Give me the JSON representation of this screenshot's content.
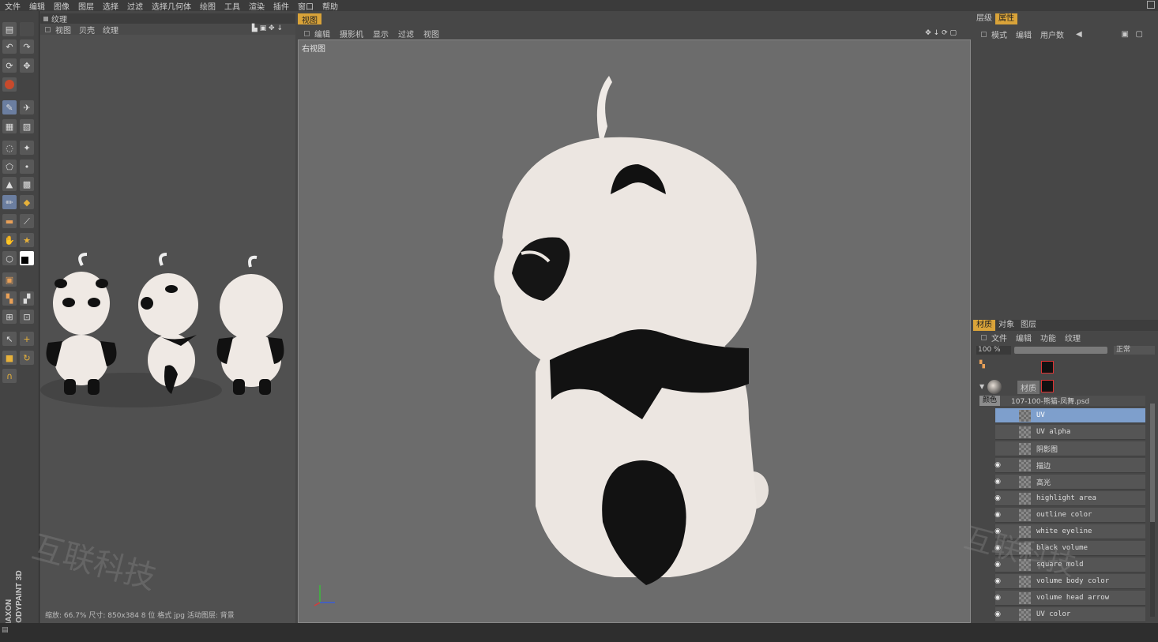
{
  "menubar": {
    "items": [
      "文件",
      "编辑",
      "图像",
      "图层",
      "选择",
      "过滤",
      "选择几何体",
      "绘图",
      "工具",
      "渲染",
      "插件",
      "窗口",
      "帮助"
    ]
  },
  "texture_panel": {
    "title": "纹理",
    "menu": [
      "视图",
      "贝壳",
      "纹理"
    ],
    "status": "缩放: 66.7%  尺寸: 850x384  8 位  格式 jpg  活动图层: 背景"
  },
  "viewport": {
    "tab": "视图",
    "menu": [
      "编辑",
      "摄影机",
      "显示",
      "过滤",
      "视图"
    ],
    "view_label": "右视图"
  },
  "attributes_panel": {
    "tabs": [
      "层级",
      "属性"
    ],
    "active_tab": "属性",
    "menu": [
      "模式",
      "编辑",
      "用户数"
    ]
  },
  "layers_panel": {
    "tabs": [
      "材质",
      "对象",
      "图层"
    ],
    "active_tab": "材质",
    "menu": [
      "文件",
      "编辑",
      "功能",
      "纹理"
    ],
    "zoom": "100 %",
    "mode": "正常",
    "material_name": "材质",
    "channel": "颜色",
    "texture_file": "107-100-熊猫-凤舞.psd",
    "layers": [
      {
        "name": "UV",
        "visible": false,
        "selected": true
      },
      {
        "name": "UV alpha",
        "visible": false,
        "selected": false
      },
      {
        "name": "阴影图",
        "visible": false,
        "selected": false
      },
      {
        "name": "描边",
        "visible": true,
        "selected": false
      },
      {
        "name": "高光",
        "visible": true,
        "selected": false
      },
      {
        "name": "highlight area",
        "visible": true,
        "selected": false
      },
      {
        "name": "outline color",
        "visible": true,
        "selected": false
      },
      {
        "name": "white eyeline",
        "visible": true,
        "selected": false
      },
      {
        "name": "black volume",
        "visible": true,
        "selected": false
      },
      {
        "name": "square mold",
        "visible": true,
        "selected": false
      },
      {
        "name": "volume body color",
        "visible": true,
        "selected": false
      },
      {
        "name": "volume head arrow",
        "visible": true,
        "selected": false
      },
      {
        "name": "UV color",
        "visible": true,
        "selected": false
      }
    ]
  },
  "watermark": {
    "text": "互联科技"
  },
  "brand": {
    "maxon": "MAXON",
    "product": "BODYPAINT 3D"
  },
  "colors": {
    "accent": "#d9a339",
    "selection": "#7e9fcc",
    "viewport_bg": "#6c6c6c"
  }
}
